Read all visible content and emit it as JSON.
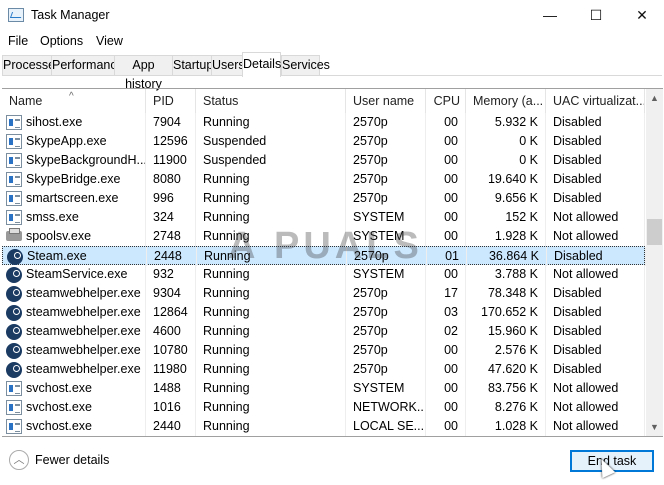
{
  "window": {
    "title": "Task Manager",
    "minimize": "—",
    "maximize": "☐",
    "close": "✕"
  },
  "menu": [
    "File",
    "Options",
    "View"
  ],
  "tabs": [
    {
      "label": "Processes"
    },
    {
      "label": "Performance"
    },
    {
      "label": "App history"
    },
    {
      "label": "Startup"
    },
    {
      "label": "Users"
    },
    {
      "label": "Details",
      "selected": true
    },
    {
      "label": "Services"
    }
  ],
  "columns": [
    "Name",
    "PID",
    "Status",
    "User name",
    "CPU",
    "Memory (a...",
    "UAC virtualizat..."
  ],
  "rows": [
    {
      "icon": "exe",
      "name": "sihost.exe",
      "pid": "7904",
      "status": "Running",
      "user": "2570p",
      "cpu": "00",
      "mem": "5.932 K",
      "uac": "Disabled"
    },
    {
      "icon": "exe",
      "name": "SkypeApp.exe",
      "pid": "12596",
      "status": "Suspended",
      "user": "2570p",
      "cpu": "00",
      "mem": "0 K",
      "uac": "Disabled"
    },
    {
      "icon": "exe",
      "name": "SkypeBackgroundH...",
      "pid": "11900",
      "status": "Suspended",
      "user": "2570p",
      "cpu": "00",
      "mem": "0 K",
      "uac": "Disabled"
    },
    {
      "icon": "exe",
      "name": "SkypeBridge.exe",
      "pid": "8080",
      "status": "Running",
      "user": "2570p",
      "cpu": "00",
      "mem": "19.640 K",
      "uac": "Disabled"
    },
    {
      "icon": "exe",
      "name": "smartscreen.exe",
      "pid": "996",
      "status": "Running",
      "user": "2570p",
      "cpu": "00",
      "mem": "9.656 K",
      "uac": "Disabled"
    },
    {
      "icon": "exe",
      "name": "smss.exe",
      "pid": "324",
      "status": "Running",
      "user": "SYSTEM",
      "cpu": "00",
      "mem": "152 K",
      "uac": "Not allowed"
    },
    {
      "icon": "print",
      "name": "spoolsv.exe",
      "pid": "2748",
      "status": "Running",
      "user": "SYSTEM",
      "cpu": "00",
      "mem": "1.928 K",
      "uac": "Not allowed"
    },
    {
      "icon": "steam",
      "name": "Steam.exe",
      "pid": "2448",
      "status": "Running",
      "user": "2570p",
      "cpu": "01",
      "mem": "36.864 K",
      "uac": "Disabled",
      "selected": true
    },
    {
      "icon": "steam",
      "name": "SteamService.exe",
      "pid": "932",
      "status": "Running",
      "user": "SYSTEM",
      "cpu": "00",
      "mem": "3.788 K",
      "uac": "Not allowed"
    },
    {
      "icon": "steam",
      "name": "steamwebhelper.exe",
      "pid": "9304",
      "status": "Running",
      "user": "2570p",
      "cpu": "17",
      "mem": "78.348 K",
      "uac": "Disabled"
    },
    {
      "icon": "steam",
      "name": "steamwebhelper.exe",
      "pid": "12864",
      "status": "Running",
      "user": "2570p",
      "cpu": "03",
      "mem": "170.652 K",
      "uac": "Disabled"
    },
    {
      "icon": "steam",
      "name": "steamwebhelper.exe",
      "pid": "4600",
      "status": "Running",
      "user": "2570p",
      "cpu": "02",
      "mem": "15.960 K",
      "uac": "Disabled"
    },
    {
      "icon": "steam",
      "name": "steamwebhelper.exe",
      "pid": "10780",
      "status": "Running",
      "user": "2570p",
      "cpu": "00",
      "mem": "2.576 K",
      "uac": "Disabled"
    },
    {
      "icon": "steam",
      "name": "steamwebhelper.exe",
      "pid": "11980",
      "status": "Running",
      "user": "2570p",
      "cpu": "00",
      "mem": "47.620 K",
      "uac": "Disabled"
    },
    {
      "icon": "exe",
      "name": "svchost.exe",
      "pid": "1488",
      "status": "Running",
      "user": "SYSTEM",
      "cpu": "00",
      "mem": "83.756 K",
      "uac": "Not allowed"
    },
    {
      "icon": "exe",
      "name": "svchost.exe",
      "pid": "1016",
      "status": "Running",
      "user": "NETWORK...",
      "cpu": "00",
      "mem": "8.276 K",
      "uac": "Not allowed"
    },
    {
      "icon": "exe",
      "name": "svchost.exe",
      "pid": "2440",
      "status": "Running",
      "user": "LOCAL SE...",
      "cpu": "00",
      "mem": "1.028 K",
      "uac": "Not allowed"
    }
  ],
  "footer": {
    "fewer_details": "Fewer details",
    "end_task": "End task"
  },
  "watermark": "A PUALS"
}
